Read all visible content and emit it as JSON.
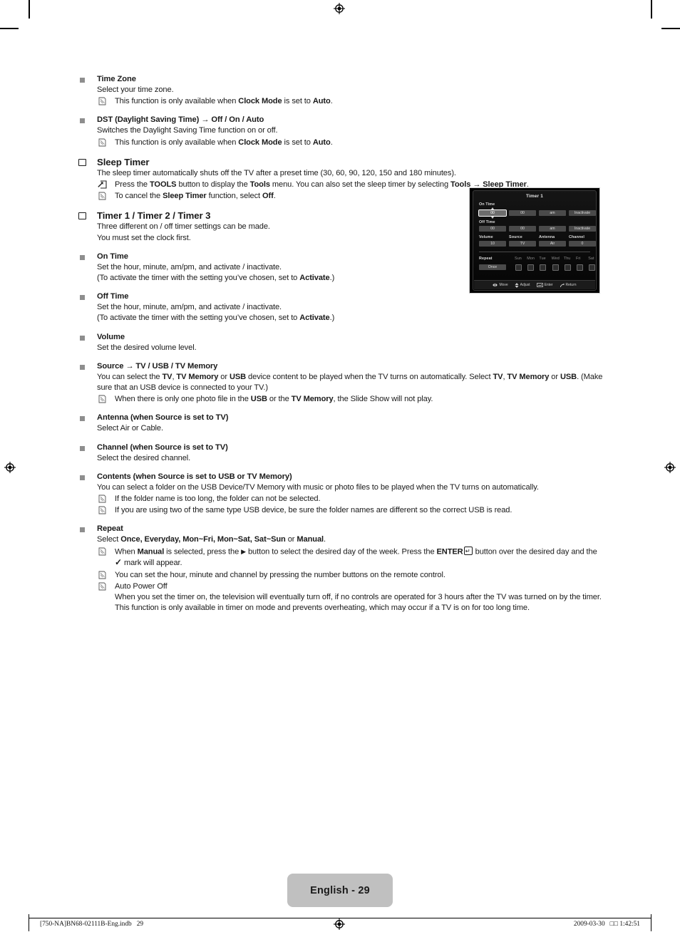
{
  "page": {
    "language_tab": "English - 29",
    "footer_left": "[750-NA]BN68-02111B-Eng.indb   29",
    "footer_right": "2009-03-30   □□ 1:42:51"
  },
  "sections": [
    {
      "id": "time-zone",
      "marker": "square",
      "heading": "Time Zone",
      "lines": [
        "Select your time zone."
      ],
      "notes": [
        {
          "icon": "note-icon",
          "html": "This function is only available when <b>Clock Mode</b> is set to <b>Auto</b>."
        }
      ]
    },
    {
      "id": "dst",
      "marker": "square",
      "heading": "DST (Daylight Saving Time) → Off / On / Auto",
      "lines": [
        "Switches the Daylight Saving Time function on or off."
      ],
      "notes": [
        {
          "icon": "note-icon",
          "html": "This function is only available when <b>Clock Mode</b> is set to <b>Auto</b>."
        }
      ]
    },
    {
      "id": "sleep-timer",
      "marker": "box",
      "heading": "Sleep Timer",
      "big": true,
      "lines": [
        "The sleep timer automatically shuts off the TV after a preset time (30, 60, 90, 120, 150 and 180 minutes)."
      ],
      "notes": [
        {
          "icon": "tools-icon",
          "html": "Press the <b>TOOLS</b> button to display the <b>Tools</b> menu. You can also set the sleep timer by selecting <b>Tools</b> → <b>Sleep Timer</b>."
        },
        {
          "icon": "note-icon",
          "html": "To cancel the <b>Sleep Timer</b> function, select <b>Off</b>."
        }
      ]
    },
    {
      "id": "timer-123",
      "marker": "box",
      "heading": "Timer 1 / Timer 2 / Timer 3",
      "big": true,
      "lines": [
        "Three different on / off timer settings can be made.",
        "You must set the clock first."
      ],
      "notes": []
    },
    {
      "id": "on-time",
      "marker": "square",
      "heading": "On Time",
      "lines": [
        "Set the hour, minute, am/pm, and activate / inactivate.",
        "(To activate the timer with the setting you’ve chosen, set to <b>Activate</b>.)"
      ],
      "notes": []
    },
    {
      "id": "off-time",
      "marker": "square",
      "heading": "Off Time",
      "lines": [
        "Set the hour, minute, am/pm, and activate / inactivate.",
        "(To activate the timer with the setting you’ve chosen, set to <b>Activate</b>.)"
      ],
      "notes": []
    },
    {
      "id": "volume",
      "marker": "square",
      "heading": "Volume",
      "lines": [
        "Set the desired volume level."
      ],
      "notes": []
    },
    {
      "id": "source",
      "marker": "square",
      "heading": "Source → TV / USB / TV Memory",
      "lines": [
        "You can select the <b>TV</b>, <b>TV Memory</b> or <b>USB</b> device content to be played when the TV turns on automatically. Select <b>TV</b>, <b>TV Memory</b> or <b>USB</b>. (Make sure that an USB device is connected to your TV.)"
      ],
      "notes": [
        {
          "icon": "note-icon",
          "html": "When there is only one photo file in the <b>USB</b> or the <b>TV Memory</b>, the Slide Show will not play."
        }
      ]
    },
    {
      "id": "antenna",
      "marker": "square",
      "heading": "Antenna (when Source is set to TV)",
      "lines": [
        "Select Air or Cable."
      ],
      "notes": []
    },
    {
      "id": "channel",
      "marker": "square",
      "heading": "Channel (when Source is set to TV)",
      "lines": [
        "Select the desired channel."
      ],
      "notes": []
    },
    {
      "id": "contents",
      "marker": "square",
      "heading": "Contents (when Source is set to USB or TV Memory)",
      "lines": [
        "You can select a folder on the USB Device/TV Memory with music or photo files to be played when the TV turns on automatically."
      ],
      "notes": [
        {
          "icon": "note-icon",
          "html": "If the folder name is too long, the folder can not be selected."
        },
        {
          "icon": "note-icon",
          "html": "If you are using two of the same type USB device, be sure the folder names are different so the correct USB is read."
        }
      ]
    },
    {
      "id": "repeat",
      "marker": "square",
      "heading": "Repeat",
      "lines": [
        "Select <b>Once, Everyday, Mon~Fri, Mon~Sat, Sat~Sun</b> or <b>Manual</b>."
      ],
      "notes": [
        {
          "icon": "note-icon",
          "html": "When <b>Manual</b> is selected, press the <span class=\"tri-r\">▶</span> button to select the desired day of the week. Press the <b>ENTER</b><span class=\"ent-key\">↵</span> button over the desired day and the <span class=\"chk-glyph\">✓</span> mark will appear."
        },
        {
          "icon": "note-icon",
          "html": "You can set the hour, minute and channel by pressing the number buttons on the remote control."
        },
        {
          "icon": "note-icon",
          "html": "Auto Power Off<br>When you set the timer on, the television will eventually turn off, if no controls are operated for 3 hours after the TV was turned on by the timer. This function is only available in timer on mode and prevents overheating, which may occur if a TV is on for too long time."
        }
      ]
    }
  ],
  "osd": {
    "title": "Timer 1",
    "labels": {
      "on_time": "On Time",
      "off_time": "Off Time",
      "volume": "Volume",
      "source": "Source",
      "antenna": "Antenna",
      "channel": "Channel",
      "repeat": "Repeat"
    },
    "on_time_row": [
      "00",
      "00",
      "am",
      "Inactivate"
    ],
    "off_time_row": [
      "00",
      "00",
      "am",
      "Inactivate"
    ],
    "settings_row": [
      "10",
      "TV",
      "Air",
      "0"
    ],
    "repeat_value": "Once",
    "days": [
      "Sun",
      "Mon",
      "Tue",
      "Wed",
      "Thu",
      "Fri",
      "Sat"
    ],
    "nav": [
      {
        "icon": "left-right-arrow-icon",
        "label": "Move"
      },
      {
        "icon": "up-down-arrow-icon",
        "label": "Adjust"
      },
      {
        "icon": "enter-key-icon",
        "label": "Enter"
      },
      {
        "icon": "return-arrow-icon",
        "label": "Return"
      }
    ]
  }
}
